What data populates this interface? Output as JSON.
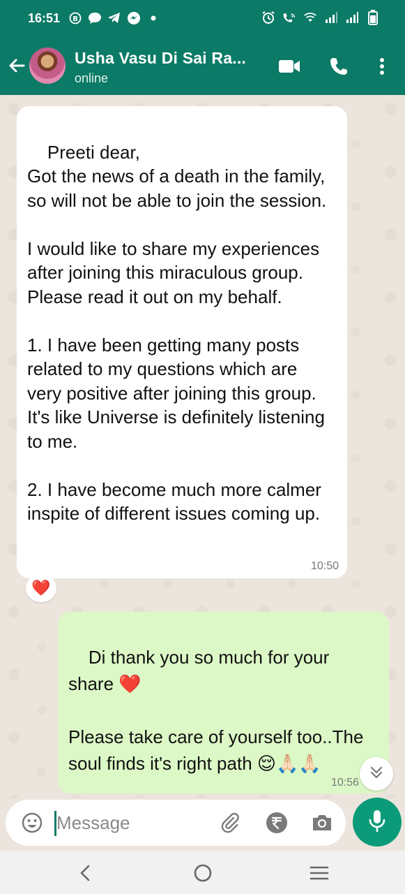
{
  "status_bar": {
    "time": "16:51",
    "left_icons": [
      "whatsapp-business-icon",
      "message-icon",
      "telegram-icon",
      "messenger-icon",
      "dot-icon"
    ],
    "right_icons": [
      "alarm-icon",
      "wifi-calling-icon",
      "wifi-icon",
      "signal-icon",
      "signal-icon",
      "battery-icon"
    ]
  },
  "header": {
    "contact_name": "Usha Vasu Di Sai Ra...",
    "status": "online",
    "icons": [
      "back-arrow-icon",
      "video-call-icon",
      "phone-icon",
      "more-vert-icon"
    ]
  },
  "messages": [
    {
      "direction": "incoming",
      "text": "Preeti dear,\nGot the news of a death in the family, so will not be able to join the session.\n\nI would like to share my experiences after joining this miraculous group. Please read it out on my behalf.\n\n1. I have been getting many posts related to my questions which are very positive after joining this group. It's like Universe is definitely listening to me.\n\n2. I have become much more calmer inspite of different issues coming up.",
      "time": "10:50",
      "reaction": "❤️"
    },
    {
      "direction": "outgoing",
      "text": "Di thank you so much for your share ❤️\n\nPlease take care of yourself too..The soul finds it's right path 😌🙏🏻🙏🏻",
      "time": "10:56"
    }
  ],
  "input": {
    "placeholder": "Message",
    "icons": [
      "emoji-icon",
      "attach-icon",
      "rupee-payment-icon",
      "camera-icon",
      "mic-icon"
    ]
  },
  "nav": {
    "icons": [
      "nav-back-icon",
      "nav-home-icon",
      "nav-recents-icon"
    ]
  },
  "colors": {
    "header": "#0b7a66",
    "outgoing_bubble": "#dcf8c6",
    "incoming_bubble": "#ffffff",
    "chat_bg": "#ece5dd",
    "mic_button": "#0b9b7a"
  }
}
